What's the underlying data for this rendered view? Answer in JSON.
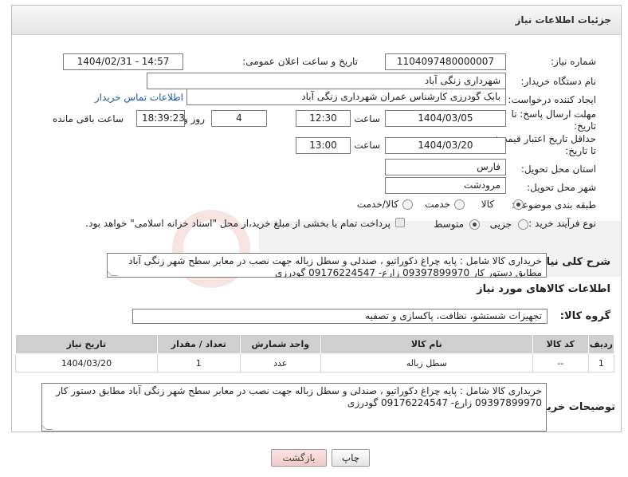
{
  "header": {
    "title": "جزئیات اطلاعات نیاز"
  },
  "form": {
    "need_number": {
      "label": "شماره نیاز:",
      "value": "1104097480000007"
    },
    "announce_datetime": {
      "label": "تاریخ و ساعت اعلان عمومی:",
      "value": "1404/02/31 - 14:57"
    },
    "buyer_org": {
      "label": "نام دستگاه خریدار:",
      "value": "شهرداری زنگی آباد"
    },
    "requester": {
      "label": "ایجاد کننده درخواست:",
      "value": "بابک گودرزی کارشناس عمران شهرداری زنگی آباد",
      "contact_link": "اطلاعات تماس خریدار"
    },
    "reply_deadline": {
      "label_line1": "مهلت ارسال پاسخ: تا",
      "label_line2": "تاریخ:",
      "date": "1404/03/05",
      "time_label": "ساعت",
      "time": "12:30",
      "days": "4",
      "days_label": "روز و",
      "remaining_time": "18:39:23",
      "remaining_label": "ساعت باقی مانده"
    },
    "price_validity": {
      "label_line1": "حداقل تاریخ اعتبار قیمت:",
      "label_line2": "تا تاریخ:",
      "date": "1404/03/20",
      "time_label": "ساعت",
      "time": "13:00"
    },
    "delivery_province": {
      "label": "استان محل تحویل:",
      "value": "فارس"
    },
    "delivery_city": {
      "label": "شهر محل تحویل:",
      "value": "مرودشت"
    },
    "category": {
      "label": "طبقه بندی موضوعی:",
      "options": [
        "کالا",
        "خدمت",
        "کالا/خدمت"
      ],
      "selected": "کالا"
    },
    "purchase_process": {
      "label": "نوع فرآیند خرید :",
      "options": [
        "جزیی",
        "متوسط"
      ],
      "selected": "متوسط",
      "treasury_note": "پرداخت تمام یا بخشی از مبلغ خرید،از محل \"اسناد خزانه اسلامی\" خواهد بود."
    },
    "general_description": {
      "label": "شرح کلی نیاز:",
      "value": "خریداری کالا شامل : پایه چراغ دکوراتیو ، صندلی و سطل زباله   جهت نصب در معابر سطح شهر  زنگی آباد  مطابق دستور کار 09397899970 زارع- 09176224547 گودرزی"
    }
  },
  "goods_section": {
    "title": "اطلاعات کالاهای مورد نیاز",
    "group_label": "گروه کالا:",
    "group_value": "تجهیزات شستشو، نظافت، پاکسازی و تصفیه"
  },
  "table": {
    "headers": [
      "ردیف",
      "کد کالا",
      "نام کالا",
      "واحد شمارش",
      "تعداد / مقدار",
      "تاریخ نیاز"
    ],
    "rows": [
      [
        "1",
        "--",
        "سطل زباله",
        "عدد",
        "1",
        "1404/03/20"
      ]
    ]
  },
  "buyer_notes": {
    "label": "توضیحات خریدار:",
    "value": "خریداری کالا شامل : پایه چراغ دکوراتیو ، صندلی و سطل زباله   جهت نصب در معابر سطح شهر  زنگی آباد  مطابق دستور کار 09397899970 زارع- 09176224547 گودرزی"
  },
  "buttons": {
    "print": "چاپ",
    "back": "بازگشت"
  },
  "colors": {
    "link": "#1a56b0",
    "back_button": "#f3c9c9",
    "table_header": "#cfcfcf"
  }
}
